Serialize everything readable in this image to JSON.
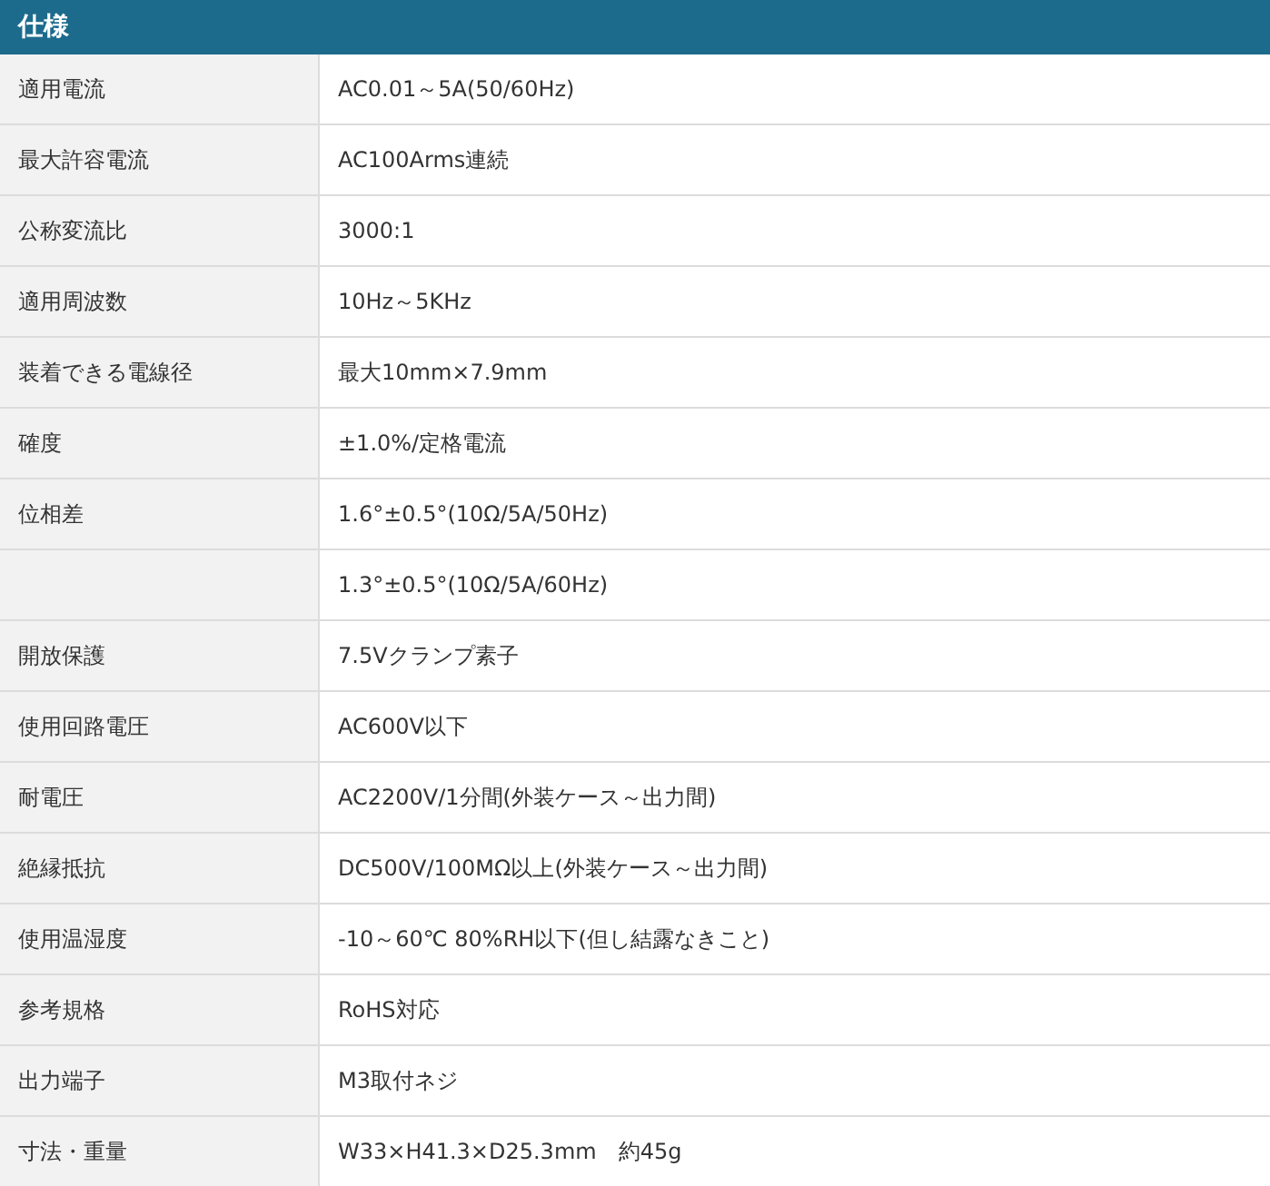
{
  "header": {
    "title": "仕様"
  },
  "rows": [
    {
      "label": "適用電流",
      "value": "AC0.01～5A(50/60Hz)"
    },
    {
      "label": "最大許容電流",
      "value": "AC100Arms連続"
    },
    {
      "label": "公称変流比",
      "value": "3000:1"
    },
    {
      "label": "適用周波数",
      "value": "10Hz～5KHz"
    },
    {
      "label": "装着できる電線径",
      "value": "最大10mm×7.9mm"
    },
    {
      "label": "確度",
      "value": "±1.0%/定格電流"
    },
    {
      "label": "位相差",
      "value": "1.6°±0.5°(10Ω/5A/50Hz)"
    },
    {
      "value": "1.3°±0.5°(10Ω/5A/60Hz)"
    },
    {
      "label": "開放保護",
      "value": "7.5Vクランプ素子"
    },
    {
      "label": "使用回路電圧",
      "value": "AC600V以下"
    },
    {
      "label": "耐電圧",
      "value": "AC2200V/1分間(外装ケース～出力間)"
    },
    {
      "label": "絶縁抵抗",
      "value": "DC500V/100MΩ以上(外装ケース～出力間)"
    },
    {
      "label": "使用温湿度",
      "value": "-10～60℃ 80%RH以下(但し結露なきこと)"
    },
    {
      "label": "参考規格",
      "value": "RoHS対応"
    },
    {
      "label": "出力端子",
      "value": "M3取付ネジ"
    },
    {
      "label": "寸法・重量",
      "value": "W33×H41.3×D25.3mm　約45g"
    }
  ]
}
